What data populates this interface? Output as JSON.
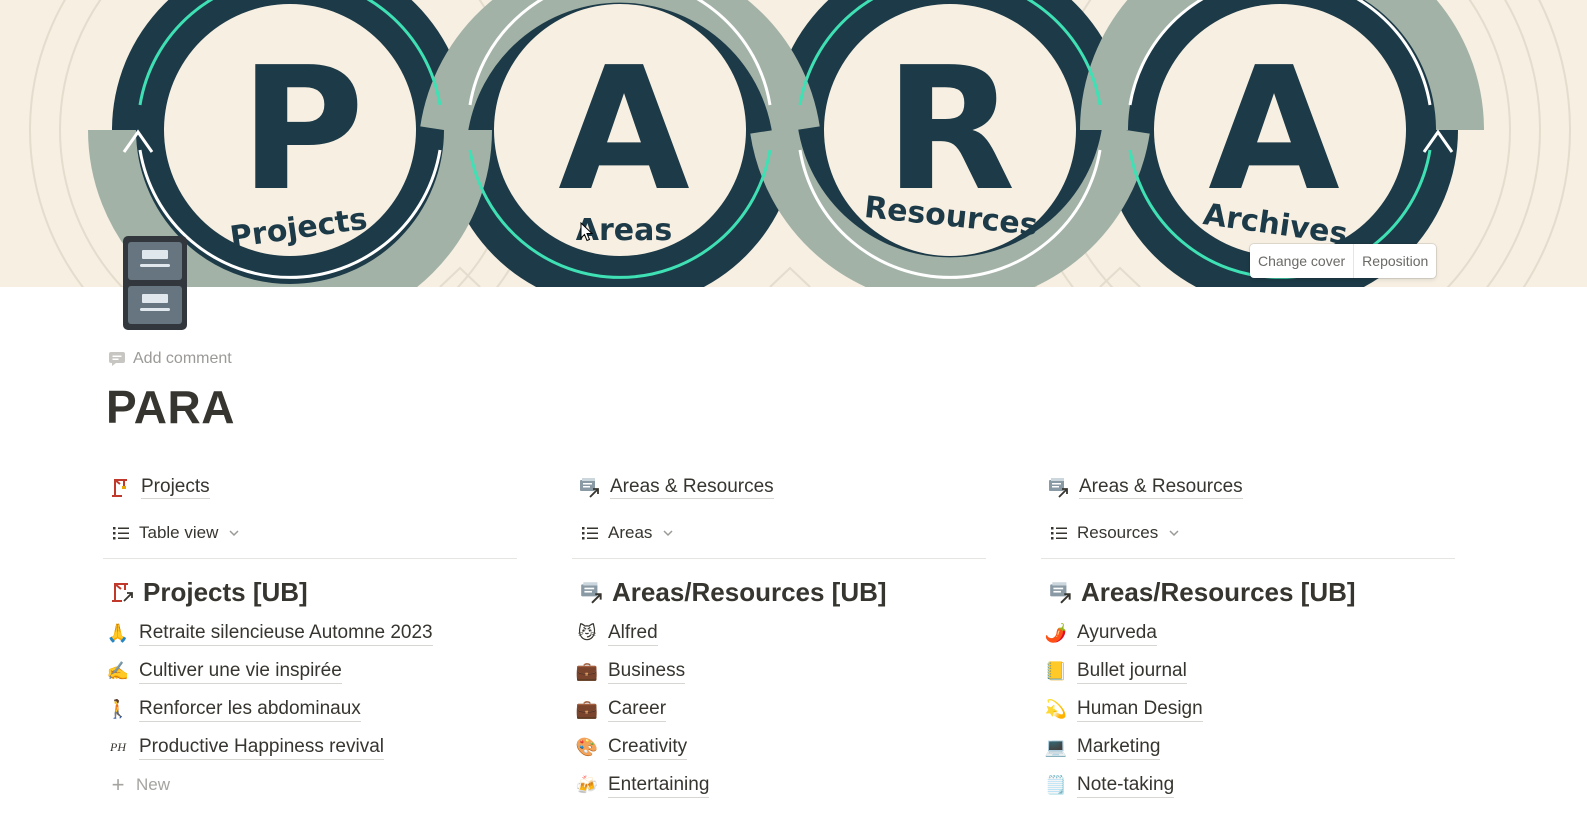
{
  "cover": {
    "letters": [
      "P",
      "A",
      "R",
      "A"
    ],
    "words": [
      "Projects",
      "Areas",
      "Resources",
      "Archives"
    ],
    "change_cover_label": "Change cover",
    "reposition_label": "Reposition"
  },
  "page": {
    "icon": "file-cabinet-icon",
    "add_comment_label": "Add comment",
    "title": "PARA"
  },
  "columns": [
    {
      "link": {
        "icon": "construction-crane-icon",
        "label": "Projects"
      },
      "view": {
        "label": "Table view"
      },
      "heading": {
        "icon": "construction-crane-arrow-icon",
        "label": "Projects [UB]"
      },
      "items": [
        {
          "emoji": "🙏",
          "label": "Retraite silencieuse Automne 2023"
        },
        {
          "emoji": "✍️",
          "label": "Cultiver une vie inspirée"
        },
        {
          "emoji": "🚶",
          "label": "Renforcer les abdominaux"
        },
        {
          "emoji": "PH",
          "label": "Productive Happiness revival"
        }
      ],
      "new_label": "New"
    },
    {
      "link": {
        "icon": "card-index-arrow-icon",
        "label": "Areas & Resources"
      },
      "view": {
        "label": "Areas"
      },
      "heading": {
        "icon": "card-index-arrow-icon",
        "label": "Areas/Resources [UB]"
      },
      "items": [
        {
          "emoji": "😼",
          "label": "Alfred"
        },
        {
          "emoji": "💼",
          "label": "Business"
        },
        {
          "emoji": "💼",
          "label": "Career"
        },
        {
          "emoji": "🎨",
          "label": "Creativity"
        },
        {
          "emoji": "🍻",
          "label": "Entertaining"
        }
      ]
    },
    {
      "link": {
        "icon": "card-index-arrow-icon",
        "label": "Areas & Resources"
      },
      "view": {
        "label": "Resources"
      },
      "heading": {
        "icon": "card-index-arrow-icon",
        "label": "Areas/Resources [UB]"
      },
      "items": [
        {
          "emoji": "🌶️",
          "label": "Ayurveda"
        },
        {
          "emoji": "📒",
          "label": "Bullet journal"
        },
        {
          "emoji": "💫",
          "label": "Human Design"
        },
        {
          "emoji": "💻",
          "label": "Marketing"
        },
        {
          "emoji": "🗒️",
          "label": "Note-taking"
        }
      ]
    }
  ],
  "colors": {
    "cover_bg": "#f6efe2",
    "dark_teal": "#1c3a47",
    "sage": "#a3b2a7",
    "mint": "#3fe0b4",
    "text": "#37352f",
    "muted": "#9b9a97"
  }
}
